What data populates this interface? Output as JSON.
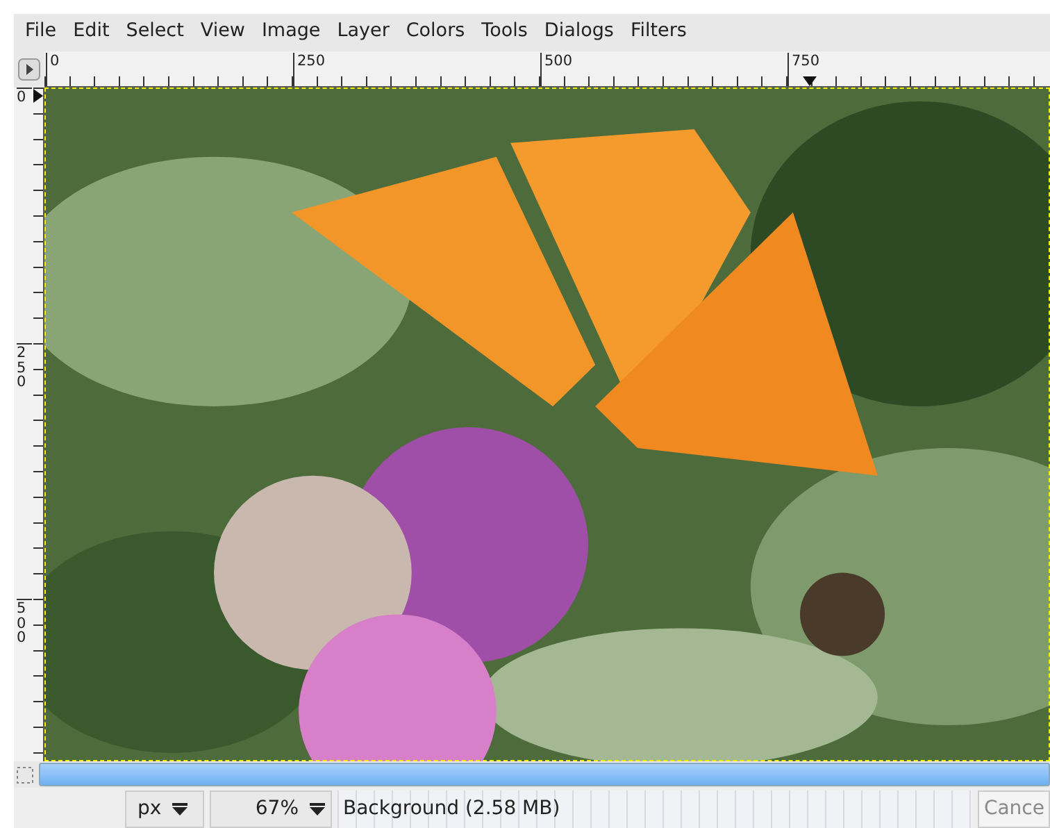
{
  "menu": [
    {
      "label": "File"
    },
    {
      "label": "Edit"
    },
    {
      "label": "Select"
    },
    {
      "label": "View"
    },
    {
      "label": "Image"
    },
    {
      "label": "Layer"
    },
    {
      "label": "Colors"
    },
    {
      "label": "Tools"
    },
    {
      "label": "Dialogs"
    },
    {
      "label": "Filters"
    }
  ],
  "h_ruler": {
    "labels": [
      "0",
      "250",
      "500",
      "750"
    ]
  },
  "v_ruler": {
    "labels": [
      "0",
      "250",
      "500"
    ]
  },
  "status_bar": {
    "unit": "px",
    "zoom": "67%",
    "message": "Background (2.58 MB)",
    "cancel": {
      "label": "Cance",
      "disabled": true
    }
  }
}
